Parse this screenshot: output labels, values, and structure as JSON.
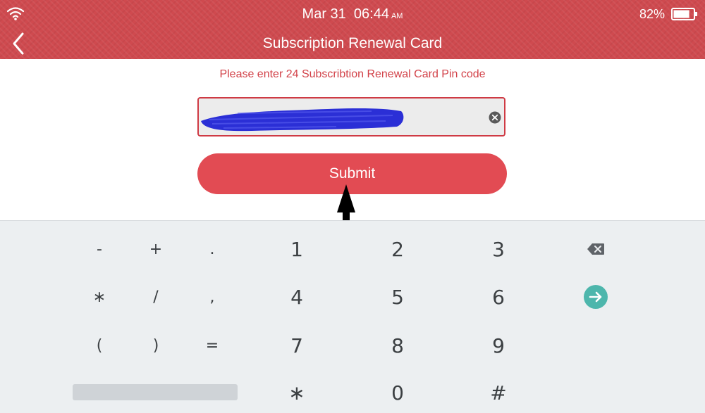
{
  "status_bar": {
    "date": "Mar 31",
    "time": "06:44",
    "ampm": "AM",
    "battery": "82%"
  },
  "header": {
    "title": "Subscription Renewal Card"
  },
  "form": {
    "prompt": "Please enter 24 Subscribtion Renewal Card Pin code",
    "submit_label": "Submit"
  },
  "keyboard": {
    "rows": [
      [
        "-",
        "+",
        ".",
        "1",
        "2",
        "3"
      ],
      [
        "∗",
        "/",
        ",",
        "4",
        "5",
        "6"
      ],
      [
        "(",
        ")",
        "=",
        "7",
        "8",
        "9"
      ],
      [
        "∗",
        "0",
        "#"
      ]
    ]
  },
  "icons": {
    "wifi": "wifi-icon",
    "battery": "battery-icon",
    "back": "back-arrow-icon",
    "clear": "clear-circle-icon",
    "backspace": "backspace-icon",
    "enter": "enter-arrow-icon"
  },
  "colors": {
    "header_bg": "#cf4a4f",
    "accent": "#e24b53",
    "prompt_text": "#d24148",
    "keyboard_bg": "#eceff1",
    "enter_key": "#4db6ac",
    "redaction": "#2b2fd6"
  }
}
